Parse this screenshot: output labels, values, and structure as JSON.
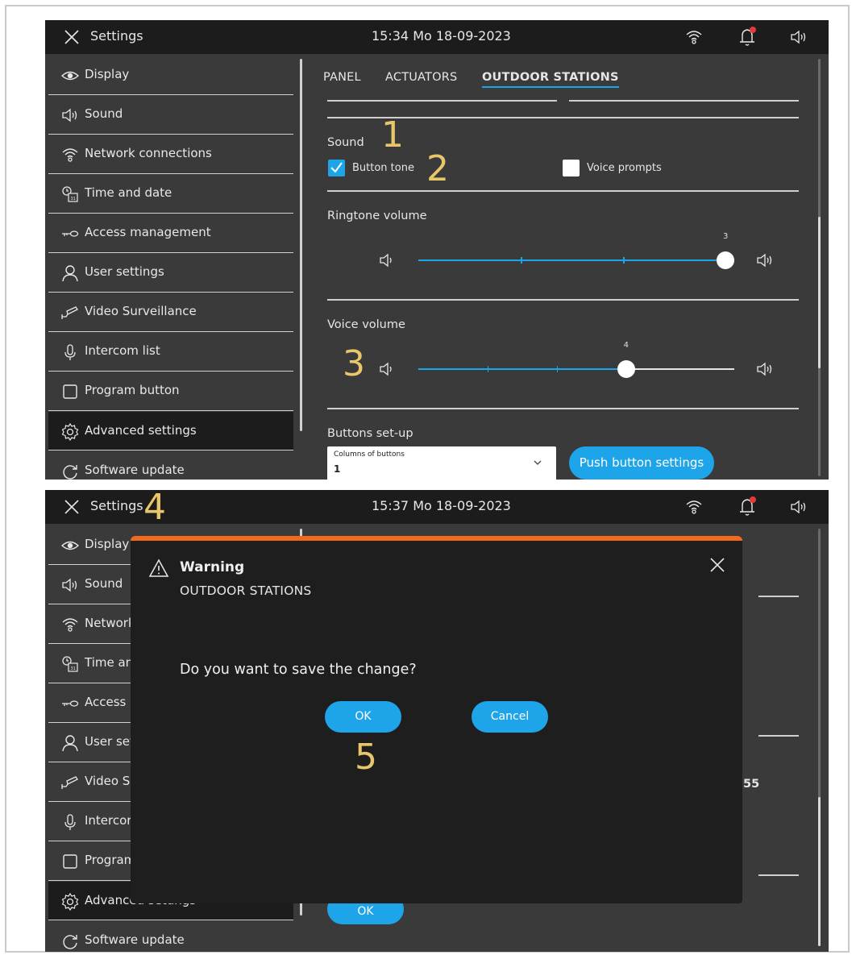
{
  "screen1": {
    "topbar": {
      "title": "Settings",
      "datetime": "15:34  Mo 18-09-2023"
    },
    "sidebar": [
      {
        "label": "Display",
        "icon": "eye-icon"
      },
      {
        "label": "Sound",
        "icon": "speaker-icon"
      },
      {
        "label": "Network connections",
        "icon": "wifi-icon"
      },
      {
        "label": "Time and date",
        "icon": "clock-calendar-icon"
      },
      {
        "label": "Access  management",
        "icon": "key-icon"
      },
      {
        "label": "User settings",
        "icon": "user-icon"
      },
      {
        "label": "Video Surveillance",
        "icon": "camera-icon"
      },
      {
        "label": "Intercom list",
        "icon": "microphone-icon"
      },
      {
        "label": "Program button",
        "icon": "square-icon"
      },
      {
        "label": "Advanced settings",
        "icon": "gear-icon",
        "active": true
      },
      {
        "label": "Software update",
        "icon": "refresh-icon"
      }
    ],
    "tabs": [
      "PANEL",
      "ACTUATORS",
      "OUTDOOR STATIONS"
    ],
    "active_tab": "OUTDOOR STATIONS",
    "sound_heading": "Sound",
    "button_tone": {
      "label": "Button tone",
      "checked": true
    },
    "voice_prompts": {
      "label": "Voice prompts",
      "checked": false
    },
    "ringtone": {
      "label": "Ringtone volume",
      "value": "3",
      "level": 3,
      "max": 3
    },
    "voice": {
      "label": "Voice volume",
      "value": "4",
      "level": 4,
      "max": 6
    },
    "buttons_setup": {
      "heading": "Buttons set-up",
      "select_caption": "Columns of buttons",
      "select_value": "1",
      "push_button": "Push button settings"
    }
  },
  "screen2": {
    "topbar": {
      "title": "Settings",
      "datetime": "15:37  Mo 18-09-2023"
    },
    "sidebar": [
      {
        "label": "Display",
        "icon": "eye-icon"
      },
      {
        "label": "Sound",
        "icon": "speaker-icon"
      },
      {
        "label": "Network",
        "icon": "wifi-icon"
      },
      {
        "label": "Time an",
        "icon": "clock-calendar-icon"
      },
      {
        "label": "Access",
        "icon": "key-icon"
      },
      {
        "label": "User set",
        "icon": "user-icon"
      },
      {
        "label": "Video Su",
        "icon": "camera-icon"
      },
      {
        "label": "Intercor",
        "icon": "microphone-icon"
      },
      {
        "label": "Program",
        "icon": "square-icon"
      },
      {
        "label": "Advanceu setungs",
        "icon": "gear-icon",
        "active": true
      },
      {
        "label": "Software update",
        "icon": "refresh-icon"
      }
    ],
    "bg_value": "55",
    "bg_ok": "OK",
    "dialog": {
      "title": "Warning",
      "subtitle": "OUTDOOR STATIONS",
      "message": "Do you want to save the change?",
      "ok": "OK",
      "cancel": "Cancel"
    }
  },
  "annotations": [
    "1",
    "2",
    "3",
    "4",
    "5"
  ],
  "colors": {
    "accent": "#1ea4e8",
    "warning": "#f06a1b",
    "annotation": "#e8c76a",
    "bg": "#3a3a3a",
    "bar": "#1c1c1c"
  }
}
